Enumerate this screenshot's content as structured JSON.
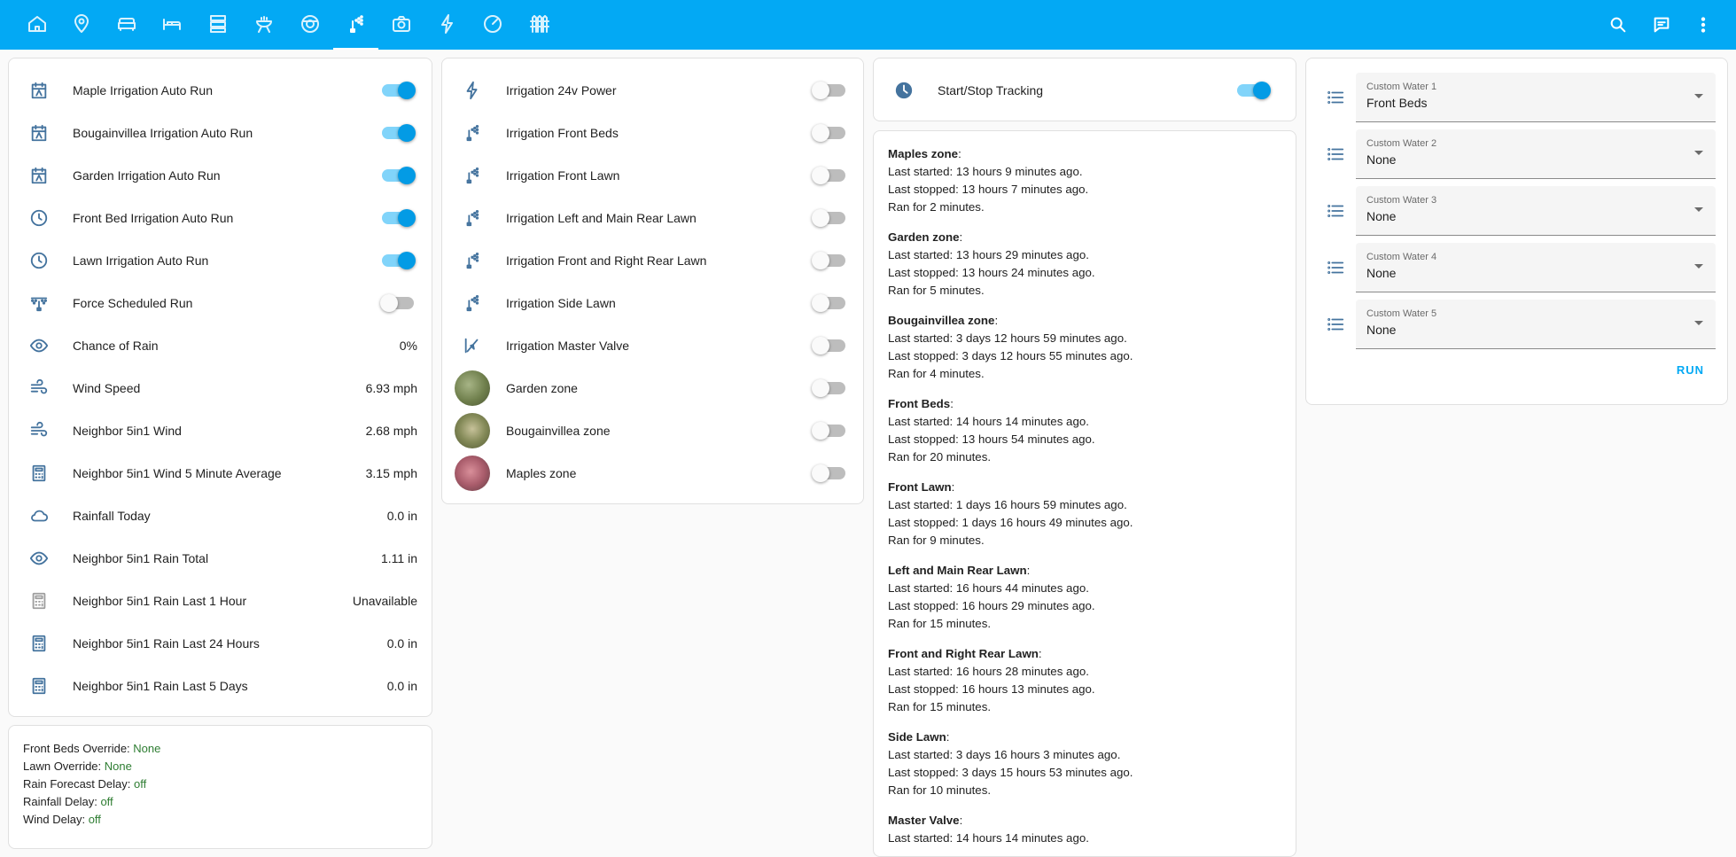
{
  "theme": {
    "primary": "#03a9f4",
    "icon": "#44739e",
    "toggle_on": "#039be5",
    "status_value": "#2e7d32"
  },
  "topbar": {
    "tabs": [
      {
        "icon": "home-icon"
      },
      {
        "icon": "map-marker-icon"
      },
      {
        "icon": "sofa-icon"
      },
      {
        "icon": "bed-icon"
      },
      {
        "icon": "server-icon"
      },
      {
        "icon": "grill-icon"
      },
      {
        "icon": "robot-vacuum-icon"
      },
      {
        "icon": "sprinkler-icon"
      },
      {
        "icon": "camera-icon"
      },
      {
        "icon": "flash-icon"
      },
      {
        "icon": "speedometer-icon"
      },
      {
        "icon": "fence-icon"
      }
    ],
    "active_tab": "sprinkler-icon",
    "actions": [
      "search-icon",
      "assist-icon",
      "more-vert-icon"
    ]
  },
  "left_card": {
    "rows": [
      {
        "icon": "calendar-auto-icon",
        "label": "Maple Irrigation Auto Run",
        "toggle": true
      },
      {
        "icon": "calendar-auto-icon",
        "label": "Bougainvillea Irrigation Auto Run",
        "toggle": true
      },
      {
        "icon": "calendar-auto-icon",
        "label": "Garden Irrigation Auto Run",
        "toggle": true
      },
      {
        "icon": "clock-icon",
        "label": "Front Bed Irrigation Auto Run",
        "toggle": true
      },
      {
        "icon": "clock-icon",
        "label": "Lawn Irrigation Auto Run",
        "toggle": true
      },
      {
        "icon": "sprinkler-variant-icon",
        "label": "Force Scheduled Run",
        "toggle": false
      },
      {
        "icon": "eye-icon",
        "label": "Chance of Rain",
        "value": "0%"
      },
      {
        "icon": "weather-windy-icon",
        "label": "Wind Speed",
        "value": "6.93 mph"
      },
      {
        "icon": "weather-windy-icon",
        "label": "Neighbor 5in1 Wind",
        "value": "2.68 mph"
      },
      {
        "icon": "calculator-icon",
        "label": "Neighbor 5in1 Wind 5 Minute Average",
        "value": "3.15 mph"
      },
      {
        "icon": "cloud-outline-icon",
        "label": "Rainfall Today",
        "value": "0.0 in"
      },
      {
        "icon": "eye-icon",
        "label": "Neighbor 5in1 Rain Total",
        "value": "1.11 in"
      },
      {
        "icon": "calculator-icon",
        "label": "Neighbor 5in1 Rain Last 1 Hour",
        "value": "Unavailable",
        "dim": true
      },
      {
        "icon": "calculator-icon",
        "label": "Neighbor 5in1 Rain Last 24 Hours",
        "value": "0.0 in"
      },
      {
        "icon": "calculator-icon",
        "label": "Neighbor 5in1 Rain Last 5 Days",
        "value": "0.0 in"
      }
    ]
  },
  "status_card": {
    "lines": [
      {
        "label": "Front Beds Override: ",
        "value": "None"
      },
      {
        "label": "Lawn Override: ",
        "value": "None"
      },
      {
        "label": "Rain Forecast Delay: ",
        "value": "off"
      },
      {
        "label": "Rainfall Delay: ",
        "value": "off"
      },
      {
        "label": "Wind Delay: ",
        "value": "off"
      }
    ]
  },
  "switch_card": {
    "rows": [
      {
        "icon": "flash-icon",
        "label": "Irrigation 24v Power",
        "toggle": false
      },
      {
        "icon": "sprinkler-icon",
        "label": "Irrigation Front Beds",
        "toggle": false
      },
      {
        "icon": "sprinkler-icon",
        "label": "Irrigation Front Lawn",
        "toggle": false
      },
      {
        "icon": "sprinkler-icon",
        "label": "Irrigation Left and Main Rear Lawn",
        "toggle": false
      },
      {
        "icon": "sprinkler-icon",
        "label": "Irrigation Front and Right Rear Lawn",
        "toggle": false
      },
      {
        "icon": "sprinkler-icon",
        "label": "Irrigation Side Lawn",
        "toggle": false
      },
      {
        "icon": "valve-icon",
        "label": "Irrigation Master Valve",
        "toggle": false
      },
      {
        "thumb": "garden",
        "label": "Garden zone",
        "toggle": false
      },
      {
        "thumb": "bougainvillea",
        "label": "Bougainvillea zone",
        "toggle": false
      },
      {
        "thumb": "maples",
        "label": "Maples zone",
        "toggle": false
      }
    ]
  },
  "tracking_card": {
    "icon": "clock-icon",
    "label": "Start/Stop Tracking",
    "toggle": true
  },
  "history": [
    {
      "zone": "Maples zone",
      "started": "Last started: 13 hours 9 minutes ago.",
      "stopped": "Last stopped: 13 hours 7 minutes ago.",
      "ran": "Ran for 2 minutes."
    },
    {
      "zone": "Garden zone",
      "started": "Last started: 13 hours 29 minutes ago.",
      "stopped": "Last stopped: 13 hours 24 minutes ago.",
      "ran": "Ran for 5 minutes."
    },
    {
      "zone": "Bougainvillea zone",
      "started": "Last started: 3 days 12 hours 59 minutes ago.",
      "stopped": "Last stopped: 3 days 12 hours 55 minutes ago.",
      "ran": "Ran for 4 minutes."
    },
    {
      "zone": "Front Beds",
      "started": "Last started: 14 hours 14 minutes ago.",
      "stopped": "Last stopped: 13 hours 54 minutes ago.",
      "ran": "Ran for 20 minutes."
    },
    {
      "zone": "Front Lawn",
      "started": "Last started: 1 days 16 hours 59 minutes ago.",
      "stopped": "Last stopped: 1 days 16 hours 49 minutes ago.",
      "ran": "Ran for 9 minutes."
    },
    {
      "zone": "Left and Main Rear Lawn",
      "started": "Last started: 16 hours 44 minutes ago.",
      "stopped": "Last stopped: 16 hours 29 minutes ago.",
      "ran": "Ran for 15 minutes."
    },
    {
      "zone": "Front and Right Rear Lawn",
      "started": "Last started: 16 hours 28 minutes ago.",
      "stopped": "Last stopped: 16 hours 13 minutes ago.",
      "ran": "Ran for 15 minutes."
    },
    {
      "zone": "Side Lawn",
      "started": "Last started: 3 days 16 hours 3 minutes ago.",
      "stopped": "Last stopped: 3 days 15 hours 53 minutes ago.",
      "ran": "Ran for 10 minutes."
    },
    {
      "zone": "Master Valve",
      "started": "Last started: 14 hours 14 minutes ago.",
      "stopped": "",
      "ran": ""
    }
  ],
  "custom_water": {
    "selects": [
      {
        "label": "Custom Water 1",
        "value": "Front Beds"
      },
      {
        "label": "Custom Water 2",
        "value": "None"
      },
      {
        "label": "Custom Water 3",
        "value": "None"
      },
      {
        "label": "Custom Water 4",
        "value": "None"
      },
      {
        "label": "Custom Water 5",
        "value": "None"
      }
    ],
    "run_label": "RUN"
  }
}
